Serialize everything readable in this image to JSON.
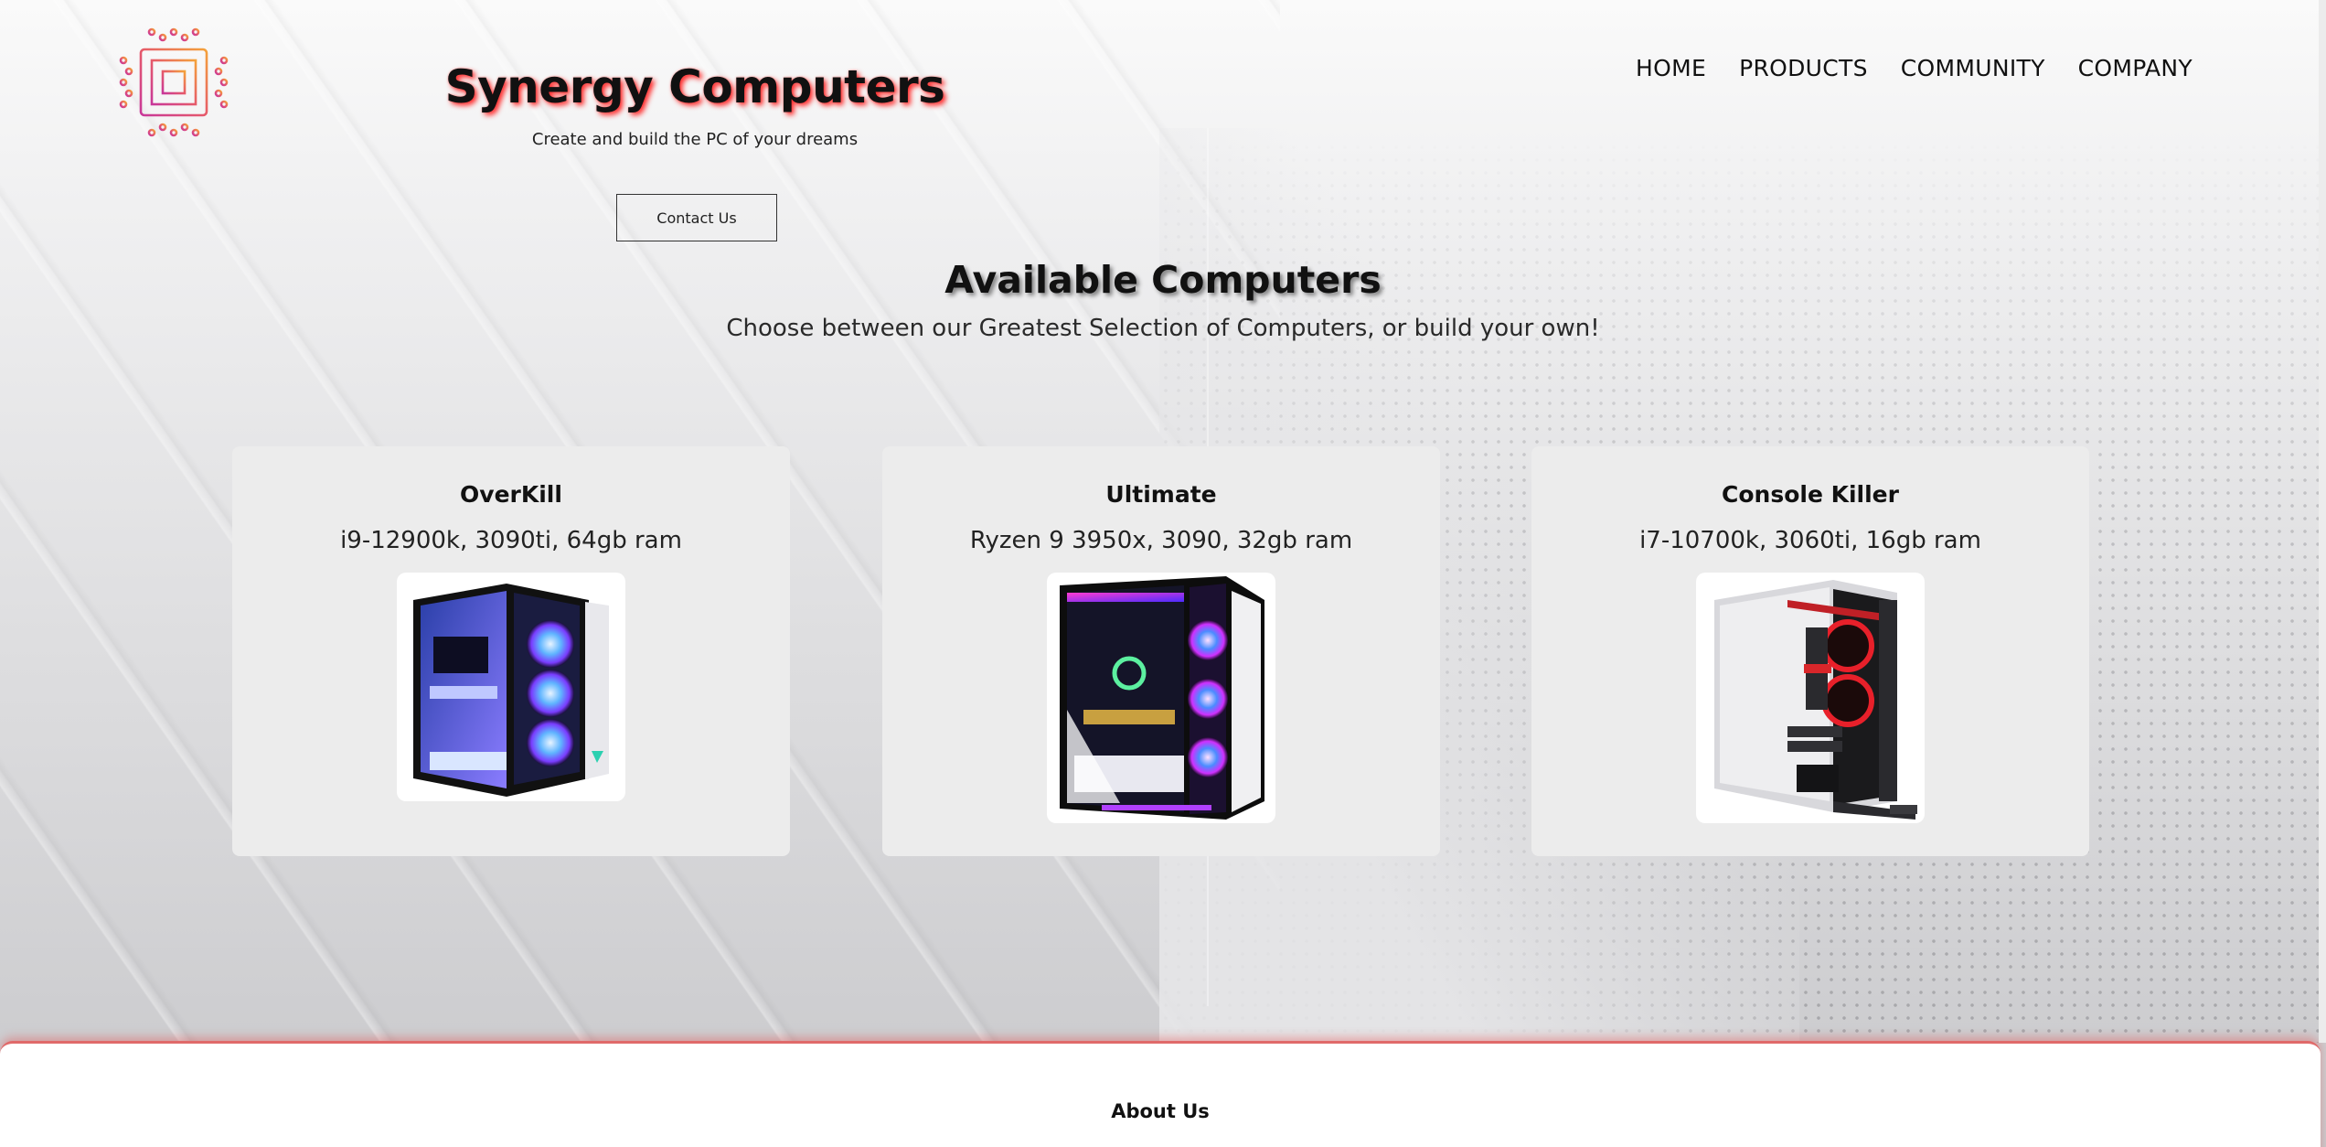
{
  "brand": {
    "title": "Synergy Computers",
    "tagline": "Create and build the PC of your dreams",
    "logo_icon": "circuit-chip-icon",
    "logo_gradient": [
      "#f08a3c",
      "#d4458a"
    ]
  },
  "header": {
    "contact_label": "Contact Us"
  },
  "nav": {
    "items": [
      {
        "label": "HOME"
      },
      {
        "label": "PRODUCTS"
      },
      {
        "label": "COMMUNITY"
      },
      {
        "label": "COMPANY"
      }
    ]
  },
  "section": {
    "title": "Available Computers",
    "subtitle": "Choose between our Greatest Selection of Computers, or build your own!"
  },
  "products": [
    {
      "name": "OverKill",
      "specs": "i9-12900k, 3090ti, 64gb ram",
      "image_icon": "pc-case-blue-rgb-image",
      "accent": "#4a7cff"
    },
    {
      "name": "Ultimate",
      "specs": "Ryzen 9 3950x, 3090, 32gb ram",
      "image_icon": "pc-case-purple-rgb-image",
      "accent": "#c23bff"
    },
    {
      "name": "Console Killer",
      "specs": "i7-10700k, 3060ti, 16gb ram",
      "image_icon": "pc-case-red-open-frame-image",
      "accent": "#e0202a"
    }
  ],
  "footer": {
    "title": "About Us"
  },
  "colors": {
    "title_glow": "#ff2a2a",
    "footer_border": "#e06a6a",
    "card_bg": "#ececec"
  }
}
